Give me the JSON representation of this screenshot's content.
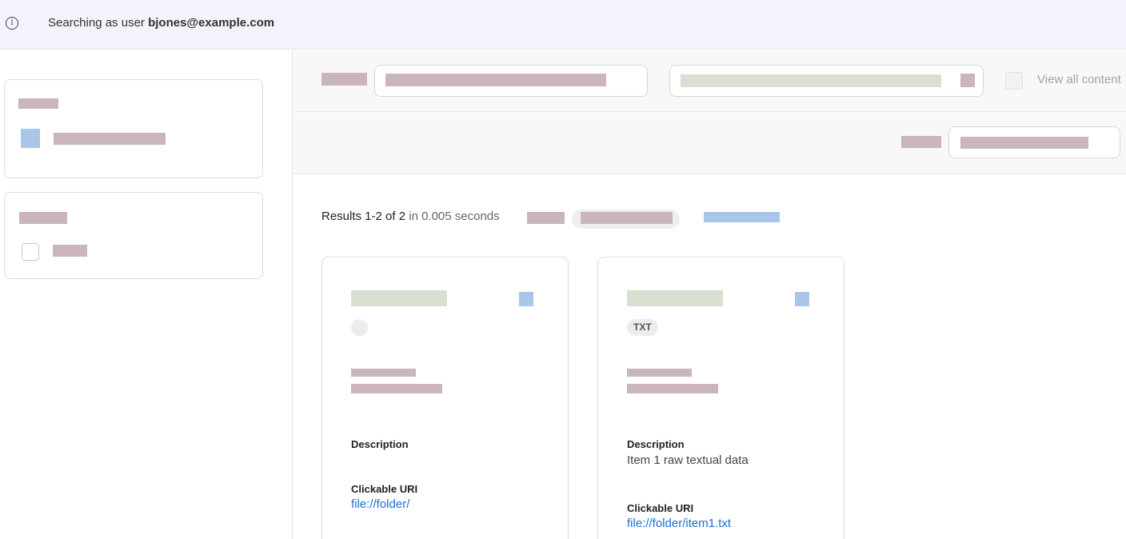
{
  "banner": {
    "icon": "info-icon",
    "prefix": "Searching as user",
    "user": "bjones@example.com"
  },
  "search": {
    "view_all_label": "View all content"
  },
  "results": {
    "count_text": "Results 1-2 of 2",
    "time_text": "in 0.005 seconds"
  },
  "cards": [
    {
      "type_badge": "",
      "description_label": "Description",
      "description_value": "",
      "uri_label": "Clickable URI",
      "uri_value": "file://folder/"
    },
    {
      "type_badge": "TXT",
      "description_label": "Description",
      "description_value": "Item 1 raw textual data",
      "uri_label": "Clickable URI",
      "uri_value": "file://folder/item1.txt"
    }
  ],
  "colors": {
    "banner_bg": "#f3f4fb",
    "link": "#1a6fd6",
    "placeholder_text": "#c9b5bb",
    "placeholder_title": "#d9e0d2",
    "placeholder_action": "#a9c6e8"
  }
}
